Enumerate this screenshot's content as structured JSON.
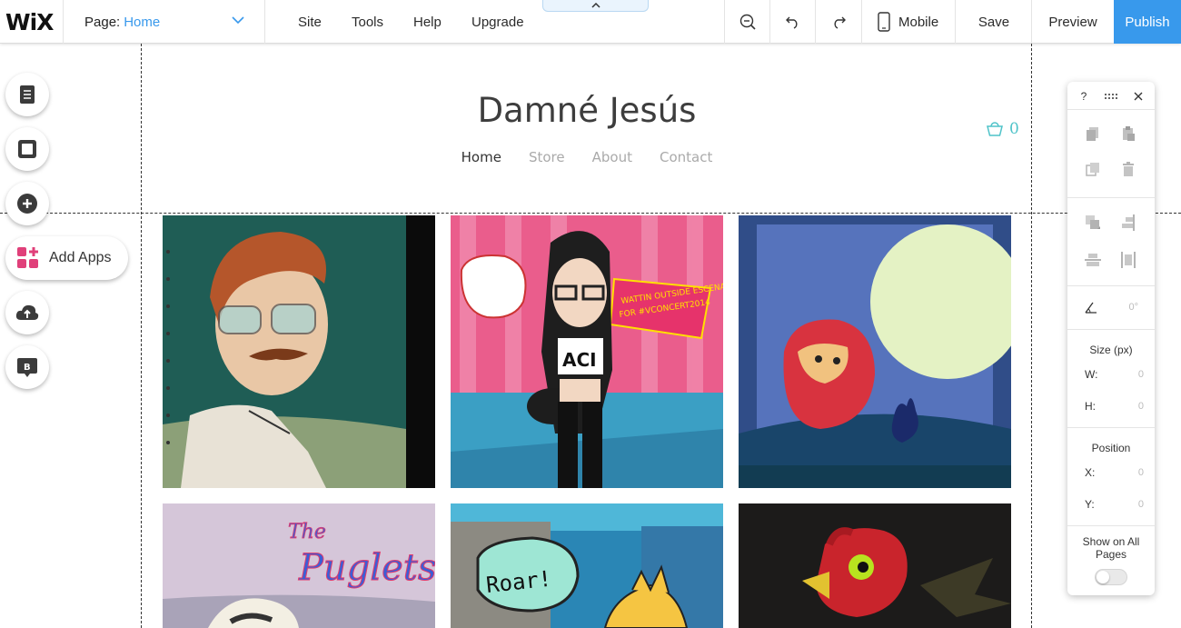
{
  "editor": {
    "logo": "WiX",
    "page_label": "Page:",
    "page_value": "Home",
    "menu": [
      "Site",
      "Tools",
      "Help",
      "Upgrade"
    ],
    "mobile_label": "Mobile",
    "save_label": "Save",
    "preview_label": "Preview",
    "publish_label": "Publish",
    "accent_color": "#3899ec"
  },
  "site": {
    "title": "Damné Jesús",
    "nav": [
      "Home",
      "Store",
      "About",
      "Contact"
    ],
    "active_nav": "Home",
    "cart_count": "0",
    "cart_color": "#4fc3c9"
  },
  "gallery": {
    "tiles": [
      {
        "name": "portrait-man-glasses"
      },
      {
        "name": "girl-wattin-outside"
      },
      {
        "name": "robot-moon-scene"
      },
      {
        "name": "the-puglets"
      },
      {
        "name": "roar-monster"
      },
      {
        "name": "red-bird"
      }
    ],
    "tile_text": {
      "wattin": "WATTIN OUTSIDE ESCENA",
      "hashtag": "FOR #VCONCERT2014",
      "shirt": "ACI",
      "the": "The",
      "puglets": "Puglets",
      "roar": "Roar!"
    }
  },
  "tools": {
    "add_apps_label": "Add Apps"
  },
  "properties": {
    "help": "?",
    "rotation": "0°",
    "size_title": "Size (px)",
    "w_label": "W:",
    "w_value": "0",
    "h_label": "H:",
    "h_value": "0",
    "position_title": "Position",
    "x_label": "X:",
    "x_value": "0",
    "y_label": "Y:",
    "y_value": "0",
    "show_all_pages": "Show on All Pages"
  }
}
